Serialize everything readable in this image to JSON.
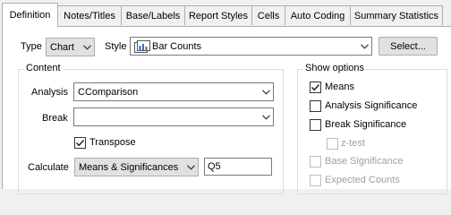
{
  "tabs": [
    {
      "label": "Definition",
      "active": true
    },
    {
      "label": "Notes/Titles"
    },
    {
      "label": "Base/Labels"
    },
    {
      "label": "Report Styles"
    },
    {
      "label": "Cells"
    },
    {
      "label": "Auto Coding"
    },
    {
      "label": "Summary Statistics"
    }
  ],
  "definition": {
    "type_label": "Type",
    "type_value": "Chart",
    "style_label": "Style",
    "style_value": "Bar Counts",
    "style_icon": "bar-chart-icon",
    "select_button": "Select..."
  },
  "content": {
    "legend": "Content",
    "analysis_label": "Analysis",
    "analysis_value": "CComparison",
    "break_label": "Break",
    "break_value": "",
    "transpose_label": "Transpose",
    "transpose_checked": true,
    "calculate_label": "Calculate",
    "calculate_value": "Means & Significances",
    "calculate_input": "Q5"
  },
  "show_options": {
    "legend": "Show options",
    "items": [
      {
        "label": "Means",
        "checked": true,
        "enabled": true
      },
      {
        "label": "Analysis Significance",
        "checked": false,
        "enabled": true
      },
      {
        "label": "Break Significance",
        "checked": false,
        "enabled": true
      },
      {
        "label": "z-test",
        "checked": false,
        "enabled": false
      },
      {
        "label": "Base Significance",
        "checked": false,
        "enabled": false
      },
      {
        "label": "Expected Counts",
        "checked": false,
        "enabled": false
      }
    ]
  }
}
